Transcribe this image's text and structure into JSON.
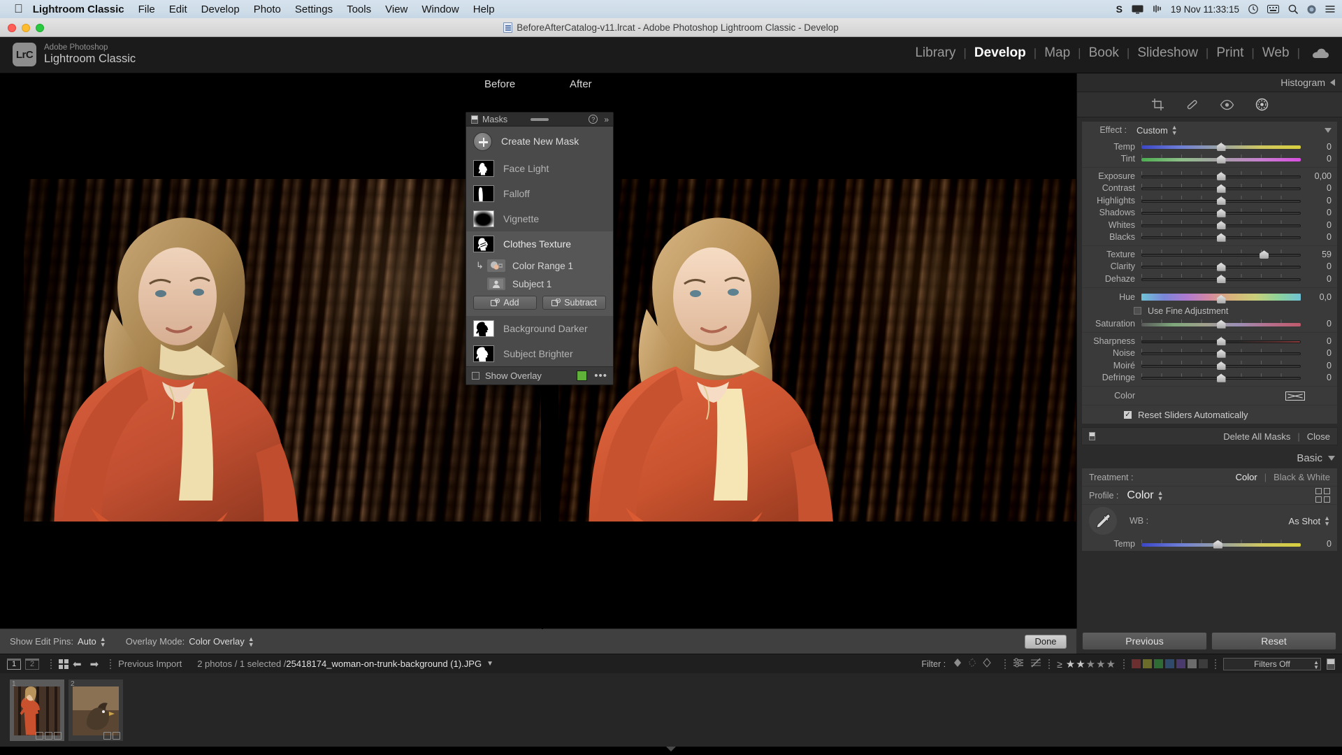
{
  "macbar": {
    "apple_icon": "apple-icon",
    "app_name": "Lightroom Classic",
    "menus": [
      "File",
      "Edit",
      "Develop",
      "Photo",
      "Settings",
      "Tools",
      "View",
      "Window",
      "Help"
    ],
    "status_items": [
      "S",
      "display-icon",
      "airplay-icon"
    ],
    "datetime": "19 Nov 11:33:15",
    "right_icons": [
      "control-center-icon",
      "keyboard-icon",
      "search-icon",
      "siri-icon",
      "list-icon"
    ]
  },
  "window": {
    "title": "BeforeAfterCatalog-v11.lrcat - Adobe Photoshop Lightroom Classic - Develop",
    "doc_icon": "document-icon"
  },
  "identity": {
    "logo_text": "LrC",
    "line1": "Adobe Photoshop",
    "line2": "Lightroom Classic"
  },
  "modules": {
    "items": [
      "Library",
      "Develop",
      "Map",
      "Book",
      "Slideshow",
      "Print",
      "Web"
    ],
    "active": "Develop",
    "cloud_icon": "cloud-icon"
  },
  "view": {
    "before_label": "Before",
    "after_label": "After"
  },
  "masks_panel": {
    "title": "Masks",
    "help_icon": "help-icon",
    "expand_icon": "chevron-double-right-icon",
    "create_label": "Create New Mask",
    "items": [
      {
        "label": "Face Light",
        "thumb": "person-mask",
        "selected": false
      },
      {
        "label": "Falloff",
        "thumb": "falloff-mask",
        "selected": false
      },
      {
        "label": "Vignette",
        "thumb": "vignette-mask",
        "selected": false
      },
      {
        "label": "Clothes Texture",
        "thumb": "clothes-mask",
        "selected": true
      },
      {
        "label": "Background Darker",
        "thumb": "background-mask",
        "selected": false
      },
      {
        "label": "Subject Brighter",
        "thumb": "subject-mask",
        "selected": false
      }
    ],
    "sub_items": [
      {
        "label": "Color Range 1",
        "icon": "color-range-icon"
      },
      {
        "label": "Subject 1",
        "icon": "subject-icon"
      }
    ],
    "add_label": "Add",
    "subtract_label": "Subtract",
    "show_overlay_label": "Show Overlay",
    "overlay_color": "#5fb13a",
    "more_icon": "ellipsis-icon"
  },
  "right_panel": {
    "histogram_title": "Histogram",
    "tools": [
      "crop-icon",
      "healing-icon",
      "redeye-icon",
      "masking-icon"
    ],
    "effect_label": "Effect :",
    "effect_value": "Custom",
    "sliders_group1": [
      {
        "name": "Temp",
        "value": "0",
        "pos": 50,
        "style": "temp"
      },
      {
        "name": "Tint",
        "value": "0",
        "pos": 50,
        "style": "tint"
      }
    ],
    "sliders_group2": [
      {
        "name": "Exposure",
        "value": "0,00",
        "pos": 50,
        "style": "plain"
      },
      {
        "name": "Contrast",
        "value": "0",
        "pos": 50,
        "style": "plain"
      },
      {
        "name": "Highlights",
        "value": "0",
        "pos": 50,
        "style": "plain"
      },
      {
        "name": "Shadows",
        "value": "0",
        "pos": 50,
        "style": "plain"
      },
      {
        "name": "Whites",
        "value": "0",
        "pos": 50,
        "style": "plain"
      },
      {
        "name": "Blacks",
        "value": "0",
        "pos": 50,
        "style": "plain"
      }
    ],
    "sliders_group3": [
      {
        "name": "Texture",
        "value": "59",
        "pos": 77,
        "style": "plain"
      },
      {
        "name": "Clarity",
        "value": "0",
        "pos": 50,
        "style": "plain"
      },
      {
        "name": "Dehaze",
        "value": "0",
        "pos": 50,
        "style": "plain"
      }
    ],
    "hue_slider": {
      "name": "Hue",
      "value": "0,0",
      "pos": 50,
      "style": "hue"
    },
    "fine_adjustment_label": "Use Fine Adjustment",
    "saturation_slider": {
      "name": "Saturation",
      "value": "0",
      "pos": 50,
      "style": "sat"
    },
    "sliders_group4": [
      {
        "name": "Sharpness",
        "value": "0",
        "pos": 50,
        "style": "sharp"
      },
      {
        "name": "Noise",
        "value": "0",
        "pos": 50,
        "style": "plain"
      },
      {
        "name": "Moiré",
        "value": "0",
        "pos": 50,
        "style": "plain"
      },
      {
        "name": "Defringe",
        "value": "0",
        "pos": 50,
        "style": "plain"
      }
    ],
    "color_label": "Color",
    "reset_sliders_label": "Reset Sliders Automatically",
    "delete_all_masks_label": "Delete All Masks",
    "close_label": "Close",
    "basic_title": "Basic",
    "treatment_label": "Treatment :",
    "treatment_color": "Color",
    "treatment_bw": "Black & White",
    "profile_label": "Profile :",
    "profile_value": "Color",
    "wb_label": "WB :",
    "wb_value": "As Shot",
    "basic_temp": {
      "name": "Temp",
      "value": "0",
      "pos": 48,
      "style": "temp"
    }
  },
  "toolbar": {
    "show_edit_pins_label": "Show Edit Pins:",
    "show_edit_pins_value": "Auto",
    "overlay_mode_label": "Overlay Mode:",
    "overlay_mode_value": "Color Overlay",
    "done_label": "Done",
    "previous_label": "Previous",
    "reset_label": "Reset"
  },
  "filmstrip_bar": {
    "page1": "1",
    "page2": "2",
    "grid_icon": "grid-icon",
    "back_icon": "arrow-left-icon",
    "forward_icon": "arrow-right-icon",
    "source": "Previous Import",
    "counts": "2 photos / 1 selected / ",
    "filename": "25418174_woman-on-trunk-background (1).JPG",
    "dropdown_icon": "chevron-down-icon",
    "filter_label": "Filter :",
    "flag_icons": [
      "flag-pick-icon",
      "flag-neutral-icon",
      "flag-reject-icon"
    ],
    "attr_icons": [
      "sliders-icon",
      "sliders-off-icon"
    ],
    "rating_op": "≥",
    "stars_filled": 2,
    "stars_total": 5,
    "color_chips": [
      "#6b2f2f",
      "#6b6b2a",
      "#2f6b35",
      "#2f4a6b",
      "#4a3a6b",
      "#6b6b6b",
      "#3c3c3c"
    ],
    "filters_off_label": "Filters Off"
  },
  "filmstrip": {
    "cells": [
      {
        "num": "1",
        "selected": true,
        "badges": 3
      },
      {
        "num": "2",
        "selected": false,
        "badges": 2
      }
    ]
  }
}
